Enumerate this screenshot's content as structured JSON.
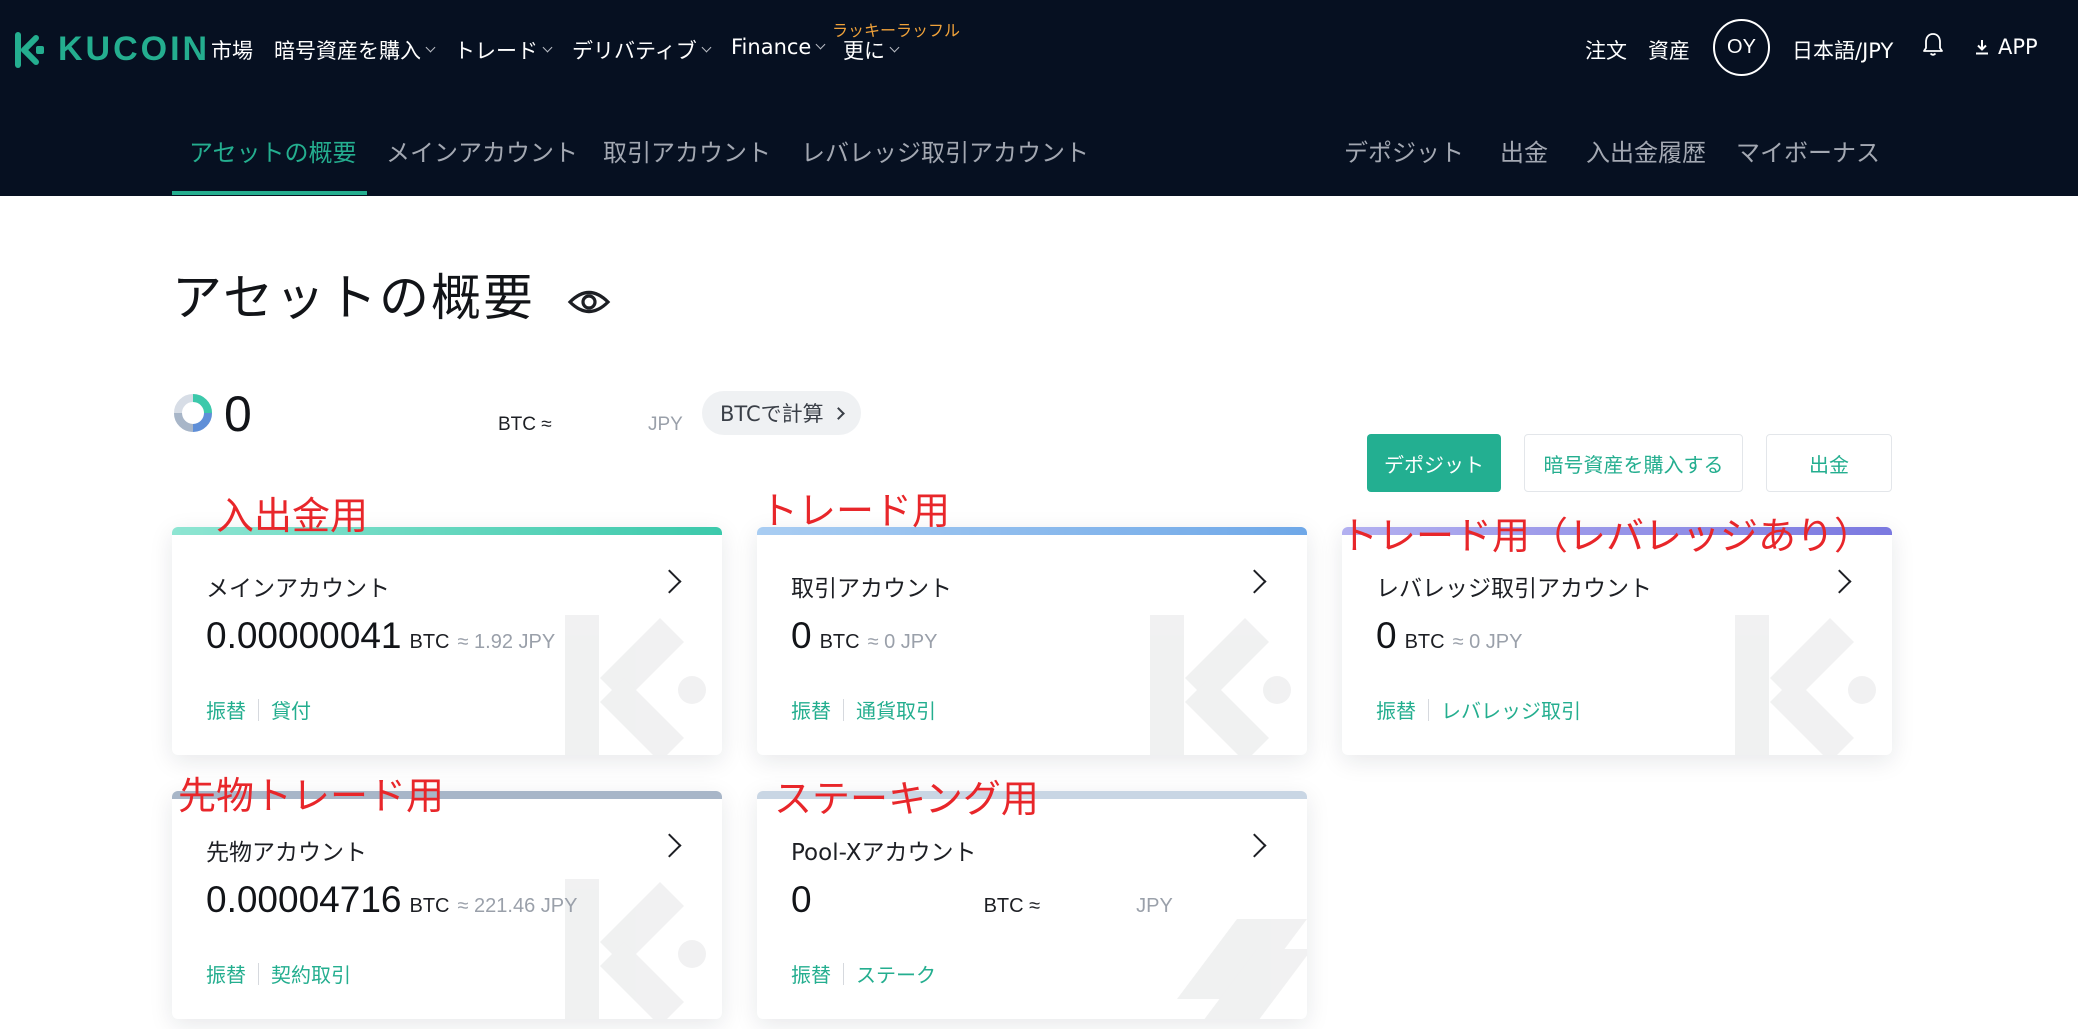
{
  "header": {
    "brand": "KUCOIN",
    "nav": [
      {
        "label": "市場"
      },
      {
        "label": "暗号資産を購入"
      },
      {
        "label": "トレード"
      },
      {
        "label": "デリバティブ"
      },
      {
        "label": "Finance"
      },
      {
        "label": "更に"
      }
    ],
    "promo": "ラッキーラッフル",
    "orders": "注文",
    "assets": "資産",
    "avatar": "OY",
    "locale": "日本語/JPY",
    "app": "APP"
  },
  "subnav": {
    "left": [
      "アセットの概要",
      "メインアカウント",
      "取引アカウント",
      "レバレッジ取引アカウント"
    ],
    "right": [
      "デポジット",
      "出金",
      "入出金履歴",
      "マイボーナス"
    ]
  },
  "overview": {
    "title": "アセットの概要",
    "total": "0",
    "btc_unit": "BTC ≈",
    "jpy_unit": "JPY",
    "calc_button": "BTCで計算"
  },
  "actions": {
    "deposit": "デポジット",
    "buy": "暗号資産を購入する",
    "withdraw": "出金"
  },
  "accounts": [
    {
      "title": "メインアカウント",
      "value": "0.00000041",
      "unit": "BTC",
      "approx": "≈ 1.92 JPY",
      "links": [
        "振替",
        "貸付"
      ],
      "bar_color": "#3cc9ab"
    },
    {
      "title": "取引アカウント",
      "value": "0",
      "unit": "BTC",
      "approx": "≈ 0 JPY",
      "links": [
        "振替",
        "通貨取引"
      ],
      "bar_color": "#6fa8e8"
    },
    {
      "title": "レバレッジ取引アカウント",
      "value": "0",
      "unit": "BTC",
      "approx": "≈ 0 JPY",
      "links": [
        "振替",
        "レバレッジ取引"
      ],
      "bar_color": "#7b79e0"
    },
    {
      "title": "先物アカウント",
      "value": "0.00004716",
      "unit": "BTC",
      "approx": "≈ 221.46 JPY",
      "links": [
        "振替",
        "契約取引"
      ],
      "bar_color": "#a8b6c8"
    },
    {
      "title": "Pool-Xアカウント",
      "value": "0",
      "unit": "BTC ≈",
      "approx": "JPY",
      "links": [
        "振替",
        "ステーク"
      ],
      "bar_color": "#c9d6e4"
    }
  ],
  "annotations": [
    "入出金用",
    "トレード用",
    "トレード用（レバレッジあり）",
    "先物トレード用",
    "ステーキング用"
  ]
}
